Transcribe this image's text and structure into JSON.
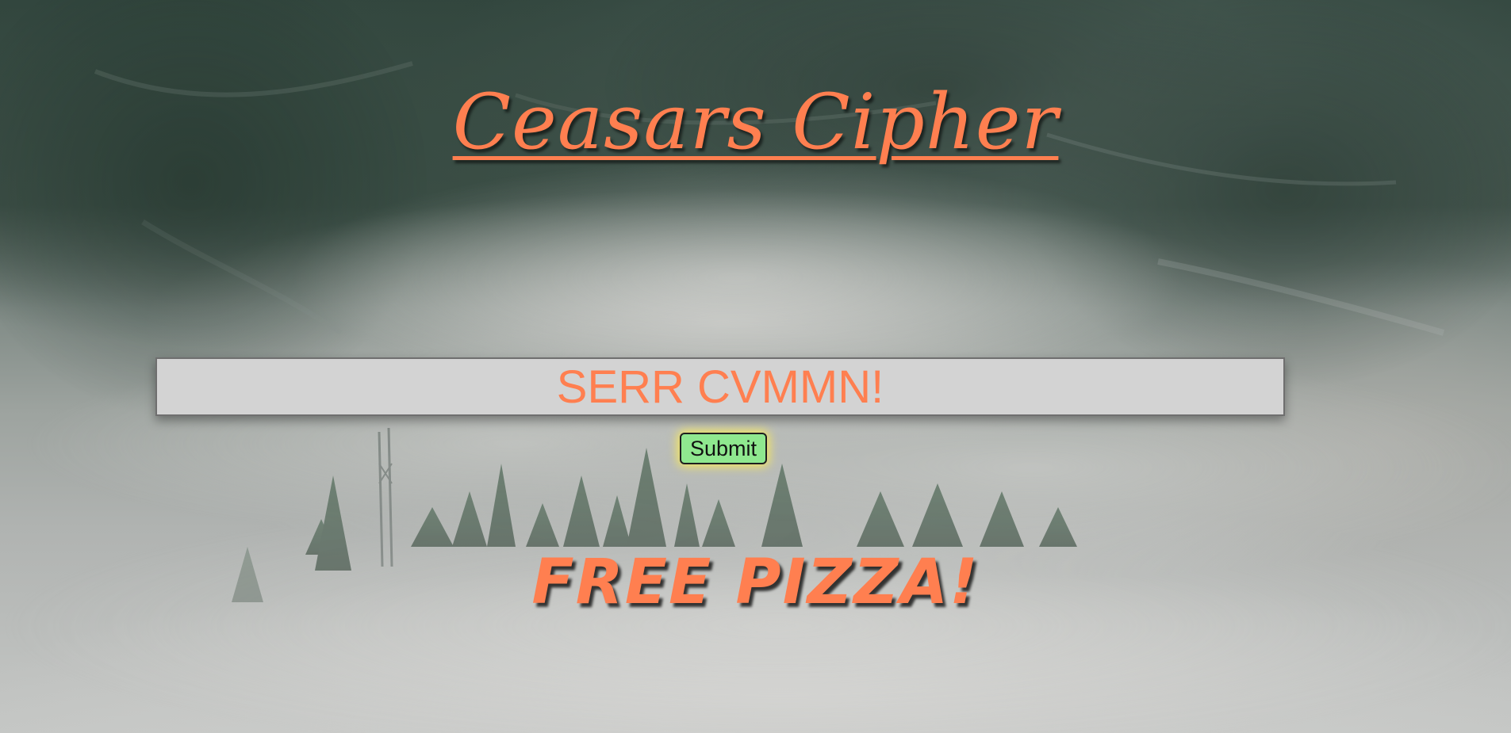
{
  "page": {
    "title": "Ceasars Cipher",
    "input_value": "SERR CVMMN!",
    "submit_label": "Submit",
    "message": "FREE PIZZA!"
  },
  "colors": {
    "accent": "#ff7f50",
    "input_background": "#d3d3d3",
    "button_background": "#8fe88f",
    "button_glow": "#ffee50"
  }
}
